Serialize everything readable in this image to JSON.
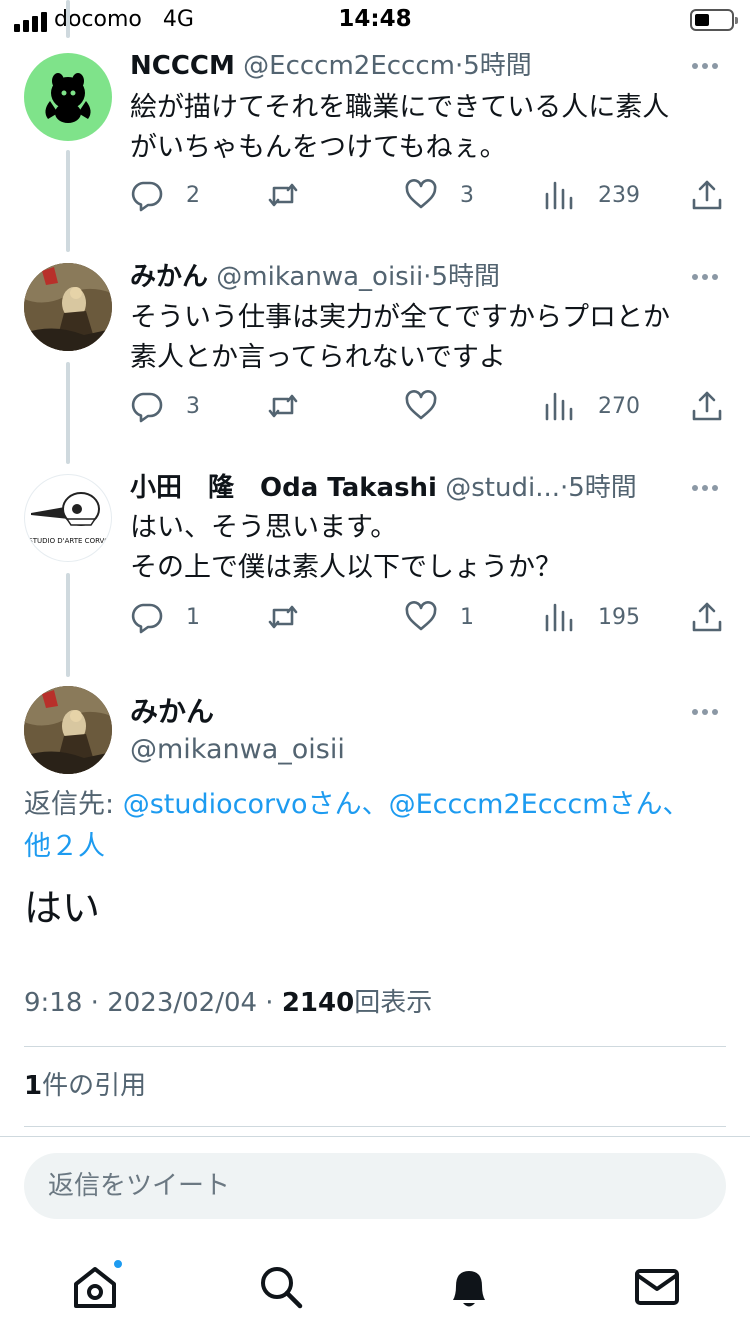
{
  "status_bar": {
    "carrier": "docomo",
    "network": "4G",
    "time": "14:48"
  },
  "tweets": [
    {
      "name": "NCCCM",
      "handle": "@Ecccm2Ecccm",
      "dot": "·",
      "time": "5時間",
      "text": "絵が描けてそれを職業にできている人に素人\nがいちゃもんをつけてもねぇ。",
      "replies": "2",
      "retweets": "",
      "likes": "3",
      "views": "239"
    },
    {
      "name": "みかん",
      "handle": "@mikanwa_oisii",
      "dot": "·",
      "time": "5時間",
      "text": "そういう仕事は実力が全てですからプロとか\n素人とか言ってられないですよ",
      "replies": "3",
      "retweets": "",
      "likes": "",
      "views": "270"
    },
    {
      "name": "小田　隆　Oda Takashi",
      "handle": "@studi...",
      "dot": "·",
      "time": "5時間",
      "text": "はい、そう思います。\nその上で僕は素人以下でしょうか？",
      "avatar_text": "STUDIO D'ARTE CORVO",
      "replies": "1",
      "retweets": "",
      "likes": "1",
      "views": "195"
    }
  ],
  "main_tweet": {
    "name": "みかん",
    "handle": "@mikanwa_oisii",
    "reply_prefix": "返信先: ",
    "reply_user1": "@studiocorvo",
    "reply_san1": "さん、",
    "reply_user2": "@Ecccm2Ecccm",
    "reply_san2": "さん、",
    "reply_others": "他２人",
    "text": "はい",
    "time": "9:18",
    "sep1": " · ",
    "date": "2023/02/04",
    "sep2": " · ",
    "views_count": "2140",
    "views_label": "回表示",
    "quote_count": "1",
    "quote_label": "件の引用"
  },
  "reply_box": {
    "placeholder": "返信をツイート"
  },
  "tab_bar": [
    "home-icon",
    "search-icon",
    "notifications-icon",
    "messages-icon"
  ],
  "colors": {
    "accent": "#1d9bf0",
    "secondary_text": "#536471",
    "line": "#cfd9de",
    "avatar_green": "#7fe38a"
  }
}
